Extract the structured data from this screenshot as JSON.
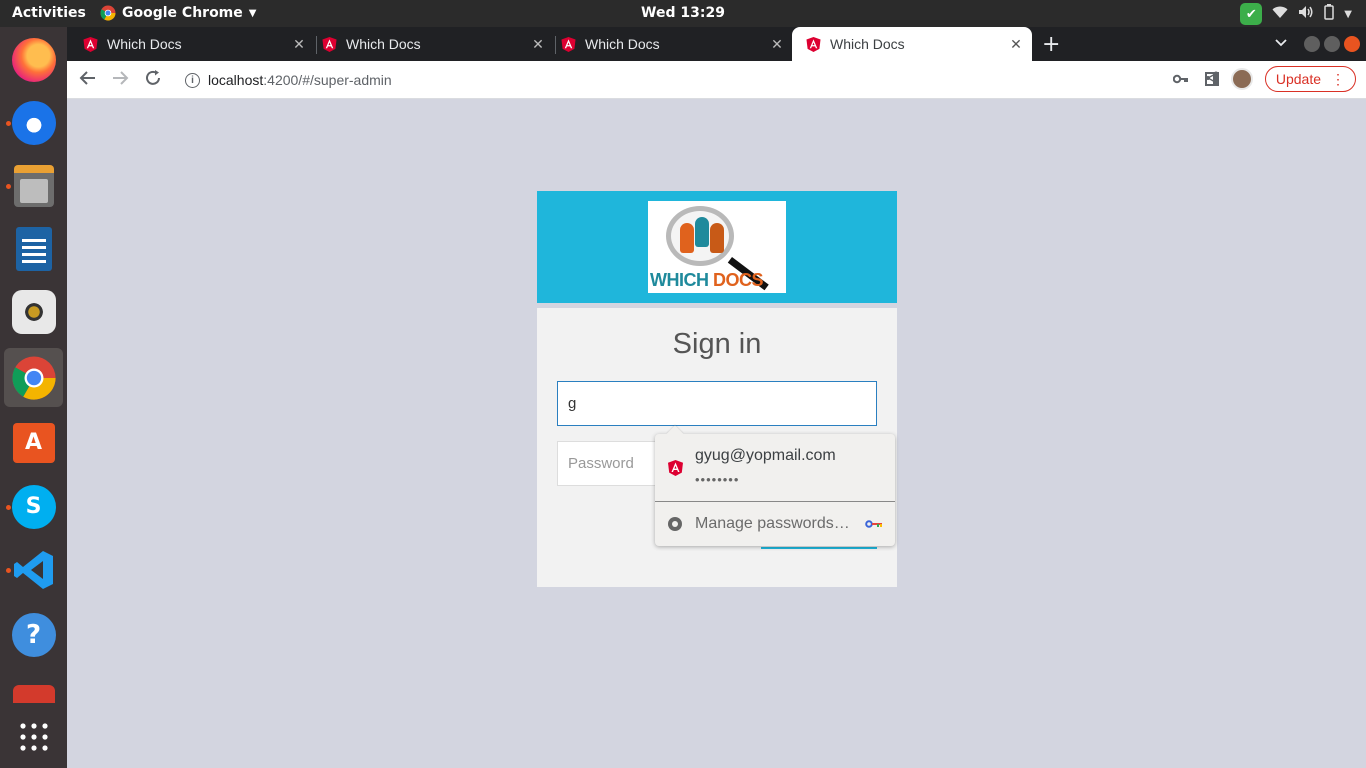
{
  "system": {
    "activities": "Activities",
    "app_name": "Google Chrome",
    "clock": "Wed 13:29"
  },
  "dock": {
    "items": [
      "firefox",
      "thunderbird",
      "files",
      "libreoffice-writer",
      "rhythmbox",
      "google-chrome",
      "ubuntu-software",
      "skype",
      "vscode",
      "help",
      "app-grid"
    ]
  },
  "browser": {
    "tabs": [
      {
        "title": "Which Docs"
      },
      {
        "title": "Which Docs"
      },
      {
        "title": "Which Docs"
      },
      {
        "title": "Which Docs"
      }
    ],
    "url": {
      "host": "localhost",
      "path": ":4200/#/super-admin"
    },
    "update_label": "Update"
  },
  "login": {
    "logo": {
      "text_a": "WHICH",
      "text_b": "DOCS"
    },
    "heading": "Sign in",
    "email_value": "g",
    "password_placeholder": "Password"
  },
  "autofill": {
    "username": "gyug@yopmail.com",
    "masked_password": "••••••••",
    "manage_label": "Manage passwords…"
  },
  "colors": {
    "header_bg": "#1fb6db",
    "page_bg": "#d3d5e0",
    "update_red": "#d93025",
    "angular_red": "#dd0031"
  }
}
